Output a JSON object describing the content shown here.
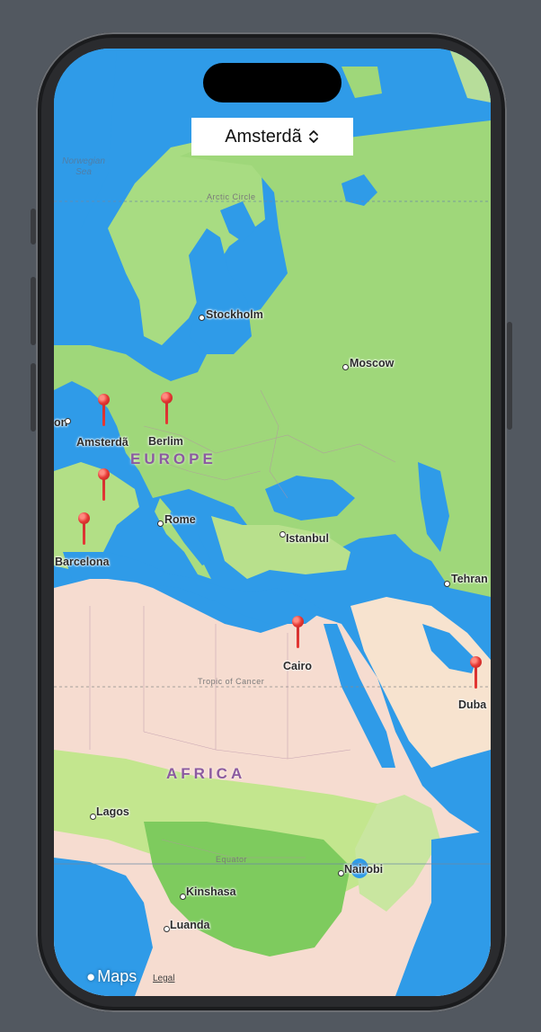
{
  "picker": {
    "label": "Amsterdã"
  },
  "seas": [
    {
      "id": "norwegian-sea",
      "line1": "Norwegian",
      "line2": "Sea"
    }
  ],
  "lines": {
    "arctic": "Arctic Circle",
    "cancer": "Tropic of Cancer",
    "equator": "Equator"
  },
  "regions": {
    "europe": "EUROPE",
    "africa": "AFRICA"
  },
  "cities": {
    "stockholm": "Stockholm",
    "moscow": "Moscow",
    "london_partial": "on",
    "amsterdam": "Amsterdã",
    "berlin": "Berlim",
    "rome": "Rome",
    "barcelona": "Barcelona",
    "istanbul": "Istanbul",
    "tehran": "Tehran",
    "cairo": "Cairo",
    "dubai": "Duba",
    "lagos": "Lagos",
    "nairobi": "Nairobi",
    "kinshasa": "Kinshasa",
    "luanda": "Luanda"
  },
  "footer": {
    "logo": "Maps",
    "legal": "Legal"
  },
  "colors": {
    "pin": "#e53935",
    "water": "#2f9be8",
    "land": "#9fd77a",
    "desert": "#f6dcd0"
  }
}
